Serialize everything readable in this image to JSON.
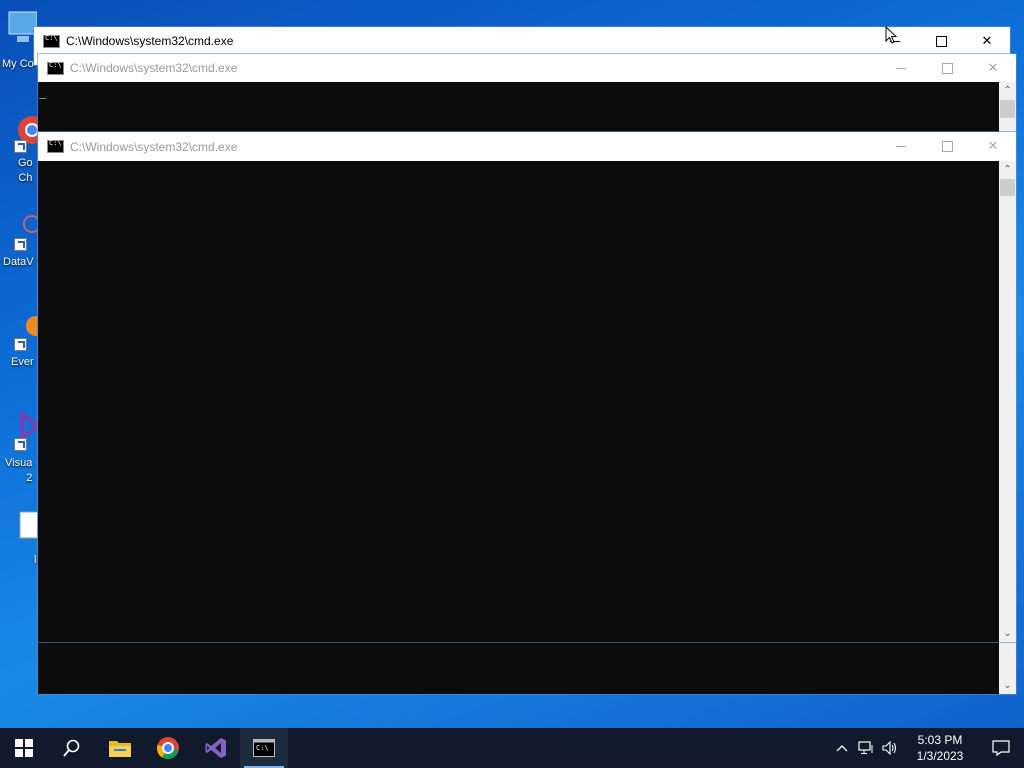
{
  "desktop": {
    "icons": [
      {
        "label": "My Co",
        "icon": "computer-icon"
      },
      {
        "label": "Go\nCh",
        "icon": "chrome-icon"
      },
      {
        "label": "DataV",
        "icon": "datavalidator-icon"
      },
      {
        "label": "Ever",
        "icon": "everything-icon"
      },
      {
        "label": "Visua\n2",
        "icon": "visual-studio-icon"
      },
      {
        "label": "l",
        "icon": "document-icon"
      }
    ]
  },
  "windows": {
    "back": {
      "title": "C:\\Windows\\system32\\cmd.exe"
    },
    "middle": {
      "title": "C:\\Windows\\system32\\cmd.exe",
      "cursor": "_"
    },
    "front": {
      "title": "C:\\Windows\\system32\\cmd.exe"
    }
  },
  "taskbar": {
    "items": [
      {
        "name": "start-button",
        "icon": "windows-logo-icon"
      },
      {
        "name": "search-button",
        "icon": "search-icon"
      },
      {
        "name": "file-explorer-button",
        "icon": "folder-icon"
      },
      {
        "name": "chrome-button",
        "icon": "chrome-icon"
      },
      {
        "name": "visual-studio-button",
        "icon": "visual-studio-icon"
      },
      {
        "name": "cmd-button",
        "icon": "cmd-icon",
        "active": true
      }
    ],
    "tray": {
      "time": "5:03 PM",
      "date": "1/3/2023"
    }
  },
  "colors": {
    "console_bg": "#0c0c0c",
    "taskbar_bg": "#101a2c",
    "accent": "#76b9ed"
  }
}
